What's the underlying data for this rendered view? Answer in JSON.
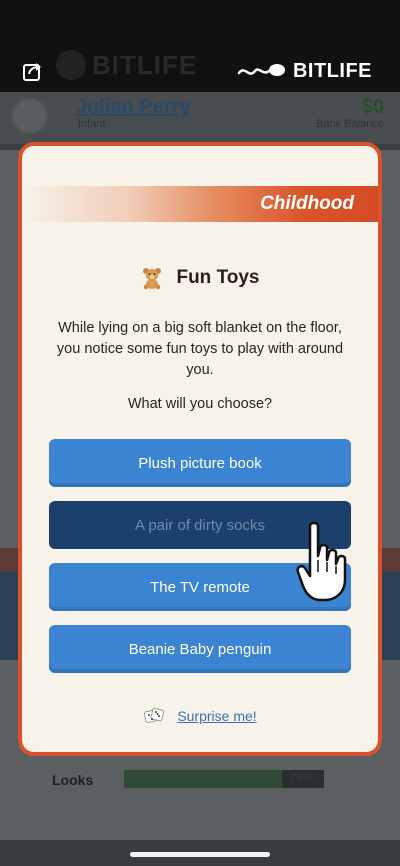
{
  "background": {
    "app_logo": "BITLIFE",
    "character_name": "Julian Perry",
    "life_stage": "Infant",
    "money": "$0",
    "money_label": "Bank Balance",
    "stat_label": "Looks",
    "stat_value": 79,
    "stat_value_label": "79%"
  },
  "modal": {
    "category": "Childhood",
    "title": "Fun Toys",
    "title_icon": "teddy-bear-icon",
    "description": "While lying on a big soft blanket on the floor, you notice some fun toys to play with around you.",
    "question": "What will you choose?",
    "choices": [
      {
        "label": "Plush picture book",
        "pressed": false
      },
      {
        "label": "A pair of dirty socks",
        "pressed": true
      },
      {
        "label": "The TV remote",
        "pressed": false
      },
      {
        "label": "Beanie Baby penguin",
        "pressed": false
      }
    ],
    "surprise_label": "Surprise me!",
    "surprise_icon": "dice-icon"
  },
  "colors": {
    "accent": "#d6532e",
    "choice_blue": "#3a84d2",
    "choice_pressed": "#1b406b",
    "modal_bg": "#f7f2ea"
  }
}
